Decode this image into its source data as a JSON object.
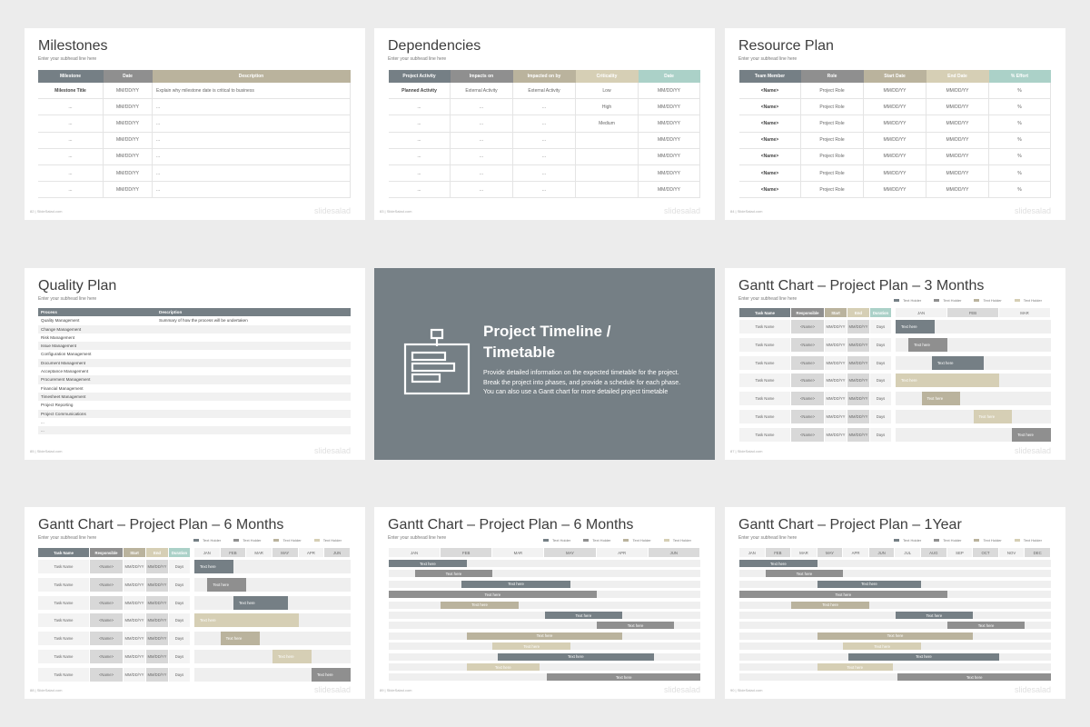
{
  "colors": {
    "slate": "#757f85",
    "gray": "#8f8f8f",
    "taupe": "#bab39d",
    "beige": "#d6cfb5",
    "teal": "#abd1c8",
    "background": "#ececec"
  },
  "brand": "slidesalad",
  "slides": [
    {
      "title": "Milestones",
      "subtitle": "Enter your subhead line here",
      "footer": "82  |  SlideSalad.com",
      "headers": [
        "Milestone",
        "Date",
        "Description"
      ],
      "rows": [
        [
          "Milestone Title",
          "MM/DD/YY",
          "Explain why milestone date is critical to business"
        ],
        [
          "...",
          "MM/DD/YY",
          "..."
        ],
        [
          "...",
          "MM/DD/YY",
          "..."
        ],
        [
          "...",
          "MM/DD/YY",
          "..."
        ],
        [
          "...",
          "MM/DD/YY",
          "..."
        ],
        [
          "...",
          "MM/DD/YY",
          "..."
        ],
        [
          "...",
          "MM/DD/YY",
          "..."
        ]
      ]
    },
    {
      "title": "Dependencies",
      "subtitle": "Enter your subhead line here",
      "footer": "83  |  SlideSalad.com",
      "headers": [
        "Project Activity",
        "Impacts on",
        "Impacted on by",
        "Criticality",
        "Date"
      ],
      "rows": [
        [
          "Planned Activity",
          "External Activity",
          "External Activity",
          "Low",
          "MM/DD/YY"
        ],
        [
          "...",
          "...",
          "...",
          "High",
          "MM/DD/YY"
        ],
        [
          "...",
          "...",
          "...",
          "Medium",
          "MM/DD/YY"
        ],
        [
          "...",
          "...",
          "...",
          "",
          "MM/DD/YY"
        ],
        [
          "...",
          "...",
          "...",
          "",
          "MM/DD/YY"
        ],
        [
          "...",
          "...",
          "...",
          "",
          "MM/DD/YY"
        ],
        [
          "...",
          "...",
          "...",
          "",
          "MM/DD/YY"
        ]
      ]
    },
    {
      "title": "Resource Plan",
      "subtitle": "Enter your subhead line here",
      "footer": "84  |  SlideSalad.com",
      "headers": [
        "Team Member",
        "Role",
        "Start Date",
        "End Date",
        "% Effort"
      ],
      "rows": [
        [
          "<Name>",
          "Project Role",
          "MM/DD/YY",
          "MM/DD/YY",
          "%"
        ],
        [
          "<Name>",
          "Project Role",
          "MM/DD/YY",
          "MM/DD/YY",
          "%"
        ],
        [
          "<Name>",
          "Project Role",
          "MM/DD/YY",
          "MM/DD/YY",
          "%"
        ],
        [
          "<Name>",
          "Project Role",
          "MM/DD/YY",
          "MM/DD/YY",
          "%"
        ],
        [
          "<Name>",
          "Project Role",
          "MM/DD/YY",
          "MM/DD/YY",
          "%"
        ],
        [
          "<Name>",
          "Project Role",
          "MM/DD/YY",
          "MM/DD/YY",
          "%"
        ],
        [
          "<Name>",
          "Project Role",
          "MM/DD/YY",
          "MM/DD/YY",
          "%"
        ]
      ]
    },
    {
      "title": "Quality Plan",
      "subtitle": "Enter your subhead line here",
      "footer": "85  |  SlideSalad.com",
      "headers": [
        "Process",
        "Description"
      ],
      "rows": [
        [
          "Quality Management",
          "Summary of how the process will be undertaken"
        ],
        [
          "Change Management",
          ""
        ],
        [
          "Risk Management",
          ""
        ],
        [
          "Issue Management",
          ""
        ],
        [
          "Configuration Management",
          ""
        ],
        [
          "Document Management",
          ""
        ],
        [
          "Acceptance Management",
          ""
        ],
        [
          "Procurement Management",
          ""
        ],
        [
          "Financial Management",
          ""
        ],
        [
          "Timesheet Management",
          ""
        ],
        [
          "Project Reporting",
          ""
        ],
        [
          "Project Communications",
          ""
        ],
        [
          "...",
          ""
        ],
        [
          "...",
          ""
        ]
      ]
    },
    {
      "title_line1": "Project Timeline /",
      "title_line2": "Timetable",
      "body": "Provide detailed information on the expected timetable for the project. Break the project into phases, and provide a schedule for each phase.",
      "body2": "You can also use a Gantt chart for more detailed project timetable",
      "icon": "gantt-chart-icon"
    },
    {
      "title": "Gantt Chart – Project Plan – 3 Months",
      "subtitle": "Enter your subhead line here",
      "footer": "87  |  SlideSalad.com",
      "legend": [
        "Text Holder",
        "Text Holder",
        "Text Holder",
        "Text Holder"
      ],
      "headers": [
        "Task Name",
        "Responsible",
        "Start",
        "End",
        "Duration"
      ],
      "months": [
        "JAN",
        "FEB",
        "MAR"
      ],
      "task_row": [
        "Task Name",
        "<Name>",
        "MM/DD/YY",
        "MM/DD/YY",
        "Days"
      ],
      "bar_label": "Text here",
      "bars": [
        {
          "start": 0,
          "len": 0.75,
          "color": "slate"
        },
        {
          "start": 0.25,
          "len": 0.75,
          "color": "gray"
        },
        {
          "start": 0.7,
          "len": 1.0,
          "color": "slate"
        },
        {
          "start": 0,
          "len": 2.0,
          "color": "beige"
        },
        {
          "start": 0.5,
          "len": 0.75,
          "color": "taupe"
        },
        {
          "start": 1.5,
          "len": 0.75,
          "color": "beige"
        },
        {
          "start": 2.25,
          "len": 0.75,
          "color": "gray"
        }
      ]
    },
    {
      "title": "Gantt Chart – Project Plan – 6 Months",
      "subtitle": "Enter your subhead line here",
      "footer": "88  |  SlideSalad.com",
      "legend": [
        "Text Holder",
        "Text Holder",
        "Text Holder",
        "Text Holder"
      ],
      "headers": [
        "Task Name",
        "Responsible",
        "Start",
        "End",
        "Duration"
      ],
      "months": [
        "JAN",
        "FEB",
        "MAR",
        "MAY",
        "APR",
        "JUN"
      ],
      "task_row": [
        "Task Name",
        "<Name>",
        "MM/DD/YY",
        "MM/DD/YY",
        "Days"
      ],
      "bar_label": "Text here",
      "bars": [
        {
          "start": 0,
          "len": 1.5,
          "color": "slate"
        },
        {
          "start": 0.5,
          "len": 1.5,
          "color": "gray"
        },
        {
          "start": 1.5,
          "len": 2.1,
          "color": "slate"
        },
        {
          "start": 0,
          "len": 4.0,
          "color": "beige"
        },
        {
          "start": 1.0,
          "len": 1.5,
          "color": "taupe"
        },
        {
          "start": 3.0,
          "len": 1.5,
          "color": "beige"
        },
        {
          "start": 4.5,
          "len": 1.5,
          "color": "gray"
        }
      ]
    },
    {
      "title": "Gantt Chart – Project Plan – 6 Months",
      "subtitle": "Enter your subhead line here",
      "footer": "89  |  SlideSalad.com",
      "legend": [
        "Text Holder",
        "Text Holder",
        "Text Holder",
        "Text Holder"
      ],
      "months": [
        "JAN",
        "FEB",
        "MAR",
        "MAY",
        "APR",
        "JUN"
      ],
      "bar_label": "Text here",
      "bars": [
        {
          "start": 0,
          "len": 1.5,
          "color": "slate"
        },
        {
          "start": 0.5,
          "len": 1.5,
          "color": "gray"
        },
        {
          "start": 1.4,
          "len": 2.1,
          "color": "slate"
        },
        {
          "start": 0,
          "len": 4.0,
          "color": "gray"
        },
        {
          "start": 1.0,
          "len": 1.5,
          "color": "taupe"
        },
        {
          "start": 3.0,
          "len": 1.5,
          "color": "slate"
        },
        {
          "start": 4.0,
          "len": 1.5,
          "color": "gray"
        },
        {
          "start": 1.5,
          "len": 3.0,
          "color": "taupe"
        },
        {
          "start": 2.0,
          "len": 1.5,
          "color": "beige"
        },
        {
          "start": 2.1,
          "len": 3.0,
          "color": "slate"
        },
        {
          "start": 1.5,
          "len": 1.4,
          "color": "beige"
        },
        {
          "start": 3.05,
          "len": 2.95,
          "color": "gray"
        }
      ]
    },
    {
      "title": "Gantt Chart – Project Plan – 1Year",
      "subtitle": "Enter your subhead line here",
      "footer": "90  |  SlideSalad.com",
      "legend": [
        "Text Holder",
        "Text Holder",
        "Text Holder",
        "Text Holder"
      ],
      "months": [
        "JAN",
        "FEB",
        "MAR",
        "MAY",
        "APR",
        "JUN",
        "JUL",
        "AUG",
        "SEP",
        "OCT",
        "NOV",
        "DEC"
      ],
      "bar_label": "Text here",
      "bars": [
        {
          "start": 0,
          "len": 3.0,
          "color": "slate"
        },
        {
          "start": 1.0,
          "len": 3.0,
          "color": "gray"
        },
        {
          "start": 3.0,
          "len": 4.0,
          "color": "slate"
        },
        {
          "start": 0,
          "len": 8.0,
          "color": "gray"
        },
        {
          "start": 2.0,
          "len": 3.0,
          "color": "taupe"
        },
        {
          "start": 6.0,
          "len": 3.0,
          "color": "slate"
        },
        {
          "start": 8.0,
          "len": 3.0,
          "color": "gray"
        },
        {
          "start": 3.0,
          "len": 6.0,
          "color": "taupe"
        },
        {
          "start": 4.0,
          "len": 3.0,
          "color": "beige"
        },
        {
          "start": 4.2,
          "len": 5.8,
          "color": "slate"
        },
        {
          "start": 3.0,
          "len": 2.9,
          "color": "beige"
        },
        {
          "start": 6.1,
          "len": 5.9,
          "color": "gray"
        }
      ]
    }
  ]
}
